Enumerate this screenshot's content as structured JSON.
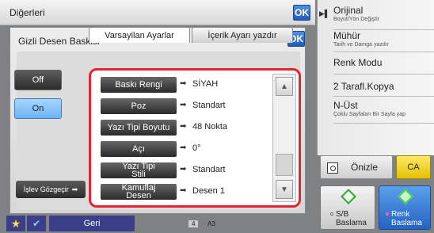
{
  "topbar": {
    "title": "Diğerleri",
    "ok": "OK"
  },
  "right_panel": {
    "items": [
      {
        "main": "Orijinal",
        "sub": "Boyut/Yön Değiştir"
      },
      {
        "main": "Mühür",
        "sub": "Tarih ve Damga yazdır"
      },
      {
        "main": "Renk Modu",
        "sub": ""
      },
      {
        "main": "2 Tarafl.Kopya",
        "sub": ""
      },
      {
        "main": "N-Üst",
        "sub": "Çoklu Sayfaları Bir Sayfa yap"
      }
    ],
    "preview_label": "Önizle",
    "ca_label": "CA",
    "start_bw": {
      "line1": "S/B",
      "line2": "Baslama"
    },
    "start_color": {
      "line1": "Renk",
      "line2": "Baslama"
    }
  },
  "dialog": {
    "title": "Gizli Desen Baskisi",
    "ok": "OK",
    "tabs": [
      "Varsayilan Ayarlar",
      "İçerik Ayarı yazdır"
    ],
    "off_label": "Off",
    "on_label": "On",
    "islev_label": "İşlev Gözgeçir",
    "settings": [
      {
        "label": "Baskı Rengi",
        "value": "SİYAH"
      },
      {
        "label": "Poz",
        "value": "Standart"
      },
      {
        "label": "Yazı Tipi Boyutu",
        "value": "48 Nokta"
      },
      {
        "label": "Açı",
        "value": "0°"
      },
      {
        "label": "Yazı Tipi Stili",
        "value": "Standart"
      },
      {
        "label": "Kamuflaj Desen",
        "value": "Desen 1"
      }
    ]
  },
  "bottombar": {
    "back_label": "Geri",
    "counter": "4",
    "paper": "A3"
  },
  "colors": {
    "accent_blue": "#2562c4",
    "highlight_red": "#e4242f",
    "ca_yellow": "#e3c200"
  }
}
